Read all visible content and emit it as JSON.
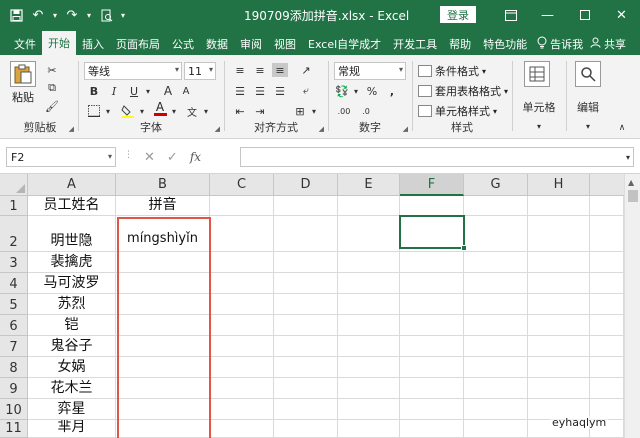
{
  "titlebar": {
    "title": "190709添加拼音.xlsx  -  Excel",
    "login": "登录"
  },
  "tabs": [
    {
      "label": "文件"
    },
    {
      "label": "开始"
    },
    {
      "label": "插入"
    },
    {
      "label": "页面布局"
    },
    {
      "label": "公式"
    },
    {
      "label": "数据"
    },
    {
      "label": "审阅"
    },
    {
      "label": "视图"
    },
    {
      "label": "Excel自学成才"
    },
    {
      "label": "开发工具"
    },
    {
      "label": "帮助"
    },
    {
      "label": "特色功能"
    }
  ],
  "tellme": "告诉我",
  "share": "共享",
  "ribbon": {
    "clipboard": {
      "label": "剪贴板",
      "paste": "粘贴"
    },
    "font": {
      "label": "字体",
      "name": "等线",
      "size": "11"
    },
    "alignment": {
      "label": "对齐方式"
    },
    "number": {
      "label": "数字",
      "format": "常规"
    },
    "styles": {
      "label": "样式",
      "conditional": "条件格式",
      "table": "套用表格格式",
      "cell_styles": "单元格样式"
    },
    "cells": {
      "label": "单元格"
    },
    "editing": {
      "label": "编辑"
    }
  },
  "formula_bar": {
    "name_box": "F2",
    "fx": "fx",
    "content": ""
  },
  "grid": {
    "columns": [
      "A",
      "B",
      "C",
      "D",
      "E",
      "F",
      "G",
      "H"
    ],
    "selected_col": "F",
    "rows": [
      {
        "num": "1",
        "a": "员工姓名",
        "b": "拼音"
      },
      {
        "num": "2",
        "a": "明世隐",
        "b": "míngshìyǐn"
      },
      {
        "num": "3",
        "a": "裴擒虎",
        "b": ""
      },
      {
        "num": "4",
        "a": "马可波罗",
        "b": ""
      },
      {
        "num": "5",
        "a": "苏烈",
        "b": ""
      },
      {
        "num": "6",
        "a": "铠",
        "b": ""
      },
      {
        "num": "7",
        "a": "鬼谷子",
        "b": ""
      },
      {
        "num": "8",
        "a": "女娲",
        "b": ""
      },
      {
        "num": "9",
        "a": "花木兰",
        "b": ""
      },
      {
        "num": "10",
        "a": "弈星",
        "b": ""
      },
      {
        "num": "11",
        "a": "芈月",
        "b": ""
      }
    ]
  },
  "watermark": "eyhaqlym"
}
